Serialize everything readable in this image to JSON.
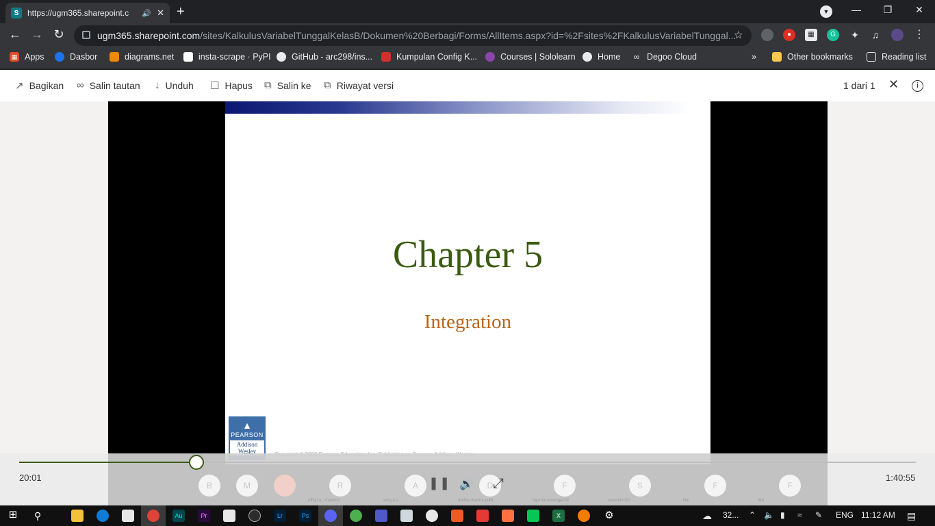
{
  "browser": {
    "tab_title": "https://ugm365.sharepoint.c",
    "url_host": "ugm365.sharepoint.com",
    "url_path": "/sites/KalkulusVariabelTunggalKelasB/Dokumen%20Berbagi/Forms/AllItems.aspx?id=%2Fsites%2FKalkulusVariabelTunggal...",
    "bookmarks": [
      "Apps",
      "Dasbor",
      "diagrams.net",
      "insta-scrape · PyPI",
      "GitHub - arc298/ins...",
      "Kumpulan Config K...",
      "Courses | Sololearn",
      "Home",
      "Degoo Cloud"
    ],
    "bookmarks_more": "»",
    "other_bookmarks": "Other bookmarks",
    "reading_list": "Reading list"
  },
  "commands": {
    "share": "Bagikan",
    "copy_link": "Salin tautan",
    "download": "Unduh",
    "delete": "Hapus",
    "copy_to": "Salin ke",
    "version_history": "Riwayat versi",
    "page_count": "1 dari 1"
  },
  "slide": {
    "title": "Chapter 5",
    "subtitle": "Integration",
    "logo_brand": "PEARSON",
    "logo_sub": "Addison Wesley",
    "copyright": "Copyright © 2008 Pearson Education, Inc.  Publishing as Pearson Addison-Wesley"
  },
  "player": {
    "elapsed": "20:01",
    "duration": "1:40:55",
    "progress": 0.198,
    "participants": [
      {
        "initial": "B",
        "label": ""
      },
      {
        "initial": "M",
        "label": ""
      },
      {
        "initial": "",
        "label": ""
      },
      {
        "initial": "R",
        "label": "effky.ra…masbou"
      },
      {
        "initial": "A",
        "label": "arsq.a.u"
      },
      {
        "initial": "D",
        "label": "dadlia.chamra.pullit"
      },
      {
        "initial": "F",
        "label": "fajarhanamangan02"
      },
      {
        "initial": "S",
        "label": "sosunthro02"
      },
      {
        "initial": "F",
        "label": "fikri"
      },
      {
        "initial": "F",
        "label": "fikri"
      }
    ]
  },
  "taskbar": {
    "weather": "32...",
    "language": "ENG",
    "clock": "11:12 AM"
  },
  "colors": {
    "chrome_dark": "#202124",
    "chrome_bar": "#35363a",
    "slide_title": "#3a5a12",
    "slide_subtitle": "#b8651a",
    "progress_accent": "#3a5a12"
  }
}
